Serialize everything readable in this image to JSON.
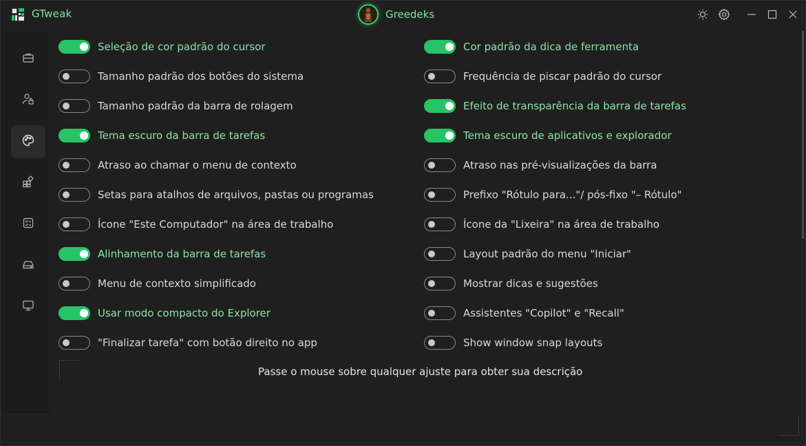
{
  "app": {
    "title": "GTweak"
  },
  "user": {
    "name": "Greedeks"
  },
  "colors": {
    "accent": "#27c466",
    "accent_text": "#8be3a8",
    "background": "#1f1f1f"
  },
  "titlebar": {
    "buttons": [
      {
        "icon": "theme-sun-icon"
      },
      {
        "icon": "settings-gear-icon"
      },
      {
        "icon": "minimize-icon"
      },
      {
        "icon": "maximize-icon"
      },
      {
        "icon": "close-icon"
      }
    ]
  },
  "sidebar": {
    "items": [
      {
        "icon": "briefcase-icon",
        "active": false
      },
      {
        "icon": "user-lock-icon",
        "active": false
      },
      {
        "icon": "palette-icon",
        "active": true
      },
      {
        "icon": "apps-grid-icon",
        "active": false
      },
      {
        "icon": "checklist-icon",
        "active": false
      },
      {
        "icon": "drive-icon",
        "active": false
      },
      {
        "icon": "monitor-icon",
        "active": false
      }
    ]
  },
  "settings": {
    "left": [
      {
        "label": "Seleção de cor padrão do cursor",
        "on": true
      },
      {
        "label": "Tamanho padrão dos botões do sistema",
        "on": false
      },
      {
        "label": "Tamanho padrão da barra de rolagem",
        "on": false
      },
      {
        "label": "Tema escuro da barra de tarefas",
        "on": true
      },
      {
        "label": "Atraso ao chamar o menu de contexto",
        "on": false
      },
      {
        "label": "Setas para atalhos de arquivos, pastas ou programas",
        "on": false
      },
      {
        "label": "Ícone \"Este Computador\" na área de trabalho",
        "on": false
      },
      {
        "label": "Alinhamento da barra de tarefas",
        "on": true
      },
      {
        "label": "Menu de contexto simplificado",
        "on": false
      },
      {
        "label": "Usar modo compacto do Explorer",
        "on": true
      },
      {
        "label": "\"Finalizar tarefa\" com botão direito no app",
        "on": false
      }
    ],
    "right": [
      {
        "label": "Cor padrão da dica de ferramenta",
        "on": true
      },
      {
        "label": "Frequência de piscar padrão do cursor",
        "on": false
      },
      {
        "label": "Efeito de transparência da barra de tarefas",
        "on": true
      },
      {
        "label": "Tema escuro de aplicativos e explorador",
        "on": true
      },
      {
        "label": "Atraso nas pré-visualizações da barra",
        "on": false
      },
      {
        "label": "Prefixo \"Rótulo para...\"/ pós-fixo \"– Rótulo\"",
        "on": false
      },
      {
        "label": "Ícone da \"Lixeira\" na área de trabalho",
        "on": false
      },
      {
        "label": "Layout padrão do menu \"Iniciar\"",
        "on": false
      },
      {
        "label": "Mostrar dicas e sugestões",
        "on": false
      },
      {
        "label": "Assistentes \"Copilot\" e \"Recall\"",
        "on": false
      },
      {
        "label": "Show window snap layouts",
        "on": false
      }
    ]
  },
  "footer": {
    "hint": "Passe o mouse sobre qualquer ajuste para obter sua descrição"
  }
}
